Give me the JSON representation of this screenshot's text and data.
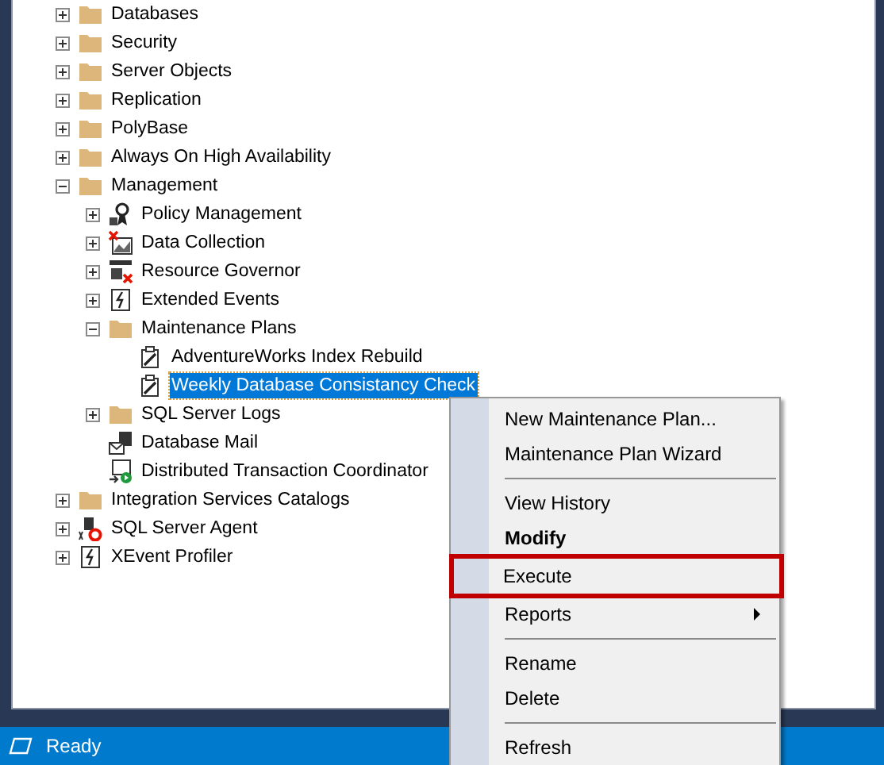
{
  "tree": [
    {
      "label": "Databases",
      "kind": "folder",
      "expanded": false,
      "selected": false
    },
    {
      "label": "Security",
      "kind": "folder",
      "expanded": false,
      "selected": false
    },
    {
      "label": "Server Objects",
      "kind": "folder",
      "expanded": false,
      "selected": false
    },
    {
      "label": "Replication",
      "kind": "folder",
      "expanded": false,
      "selected": false
    },
    {
      "label": "PolyBase",
      "kind": "folder",
      "expanded": false,
      "selected": false
    },
    {
      "label": "Always On High Availability",
      "kind": "folder",
      "expanded": false,
      "selected": false
    },
    {
      "label": "Management",
      "kind": "folder",
      "expanded": true,
      "selected": false,
      "children": [
        {
          "label": "Policy Management",
          "kind": "policy",
          "expanded": false,
          "selected": false
        },
        {
          "label": "Data Collection",
          "kind": "collection",
          "expanded": false,
          "selected": false
        },
        {
          "label": "Resource Governor",
          "kind": "governor",
          "expanded": false,
          "selected": false
        },
        {
          "label": "Extended Events",
          "kind": "events",
          "expanded": false,
          "selected": false
        },
        {
          "label": "Maintenance Plans",
          "kind": "folder",
          "expanded": true,
          "selected": false,
          "children": [
            {
              "label": "AdventureWorks Index Rebuild",
              "kind": "plan",
              "selected": false
            },
            {
              "label": "Weekly Database Consistancy Check",
              "kind": "plan",
              "selected": true
            }
          ]
        },
        {
          "label": "SQL Server Logs",
          "kind": "folder",
          "expanded": false,
          "selected": false
        },
        {
          "label": "Database Mail",
          "kind": "mail",
          "selected": false
        },
        {
          "label": "Distributed Transaction Coordinator",
          "kind": "dtc",
          "selected": false
        }
      ]
    },
    {
      "label": "Integration Services Catalogs",
      "kind": "folder",
      "expanded": false,
      "selected": false
    },
    {
      "label": "SQL Server Agent",
      "kind": "agent",
      "expanded": false,
      "selected": false
    },
    {
      "label": "XEvent Profiler",
      "kind": "events",
      "expanded": false,
      "selected": false
    }
  ],
  "context_menu": [
    {
      "kind": "item",
      "label": "New Maintenance Plan..."
    },
    {
      "kind": "item",
      "label": "Maintenance Plan Wizard"
    },
    {
      "kind": "separator"
    },
    {
      "kind": "item",
      "label": "View History"
    },
    {
      "kind": "item",
      "label": "Modify",
      "bold": true
    },
    {
      "kind": "item",
      "label": "Execute",
      "highlighted": true
    },
    {
      "kind": "item",
      "label": "Reports",
      "submenu": true
    },
    {
      "kind": "separator"
    },
    {
      "kind": "item",
      "label": "Rename"
    },
    {
      "kind": "item",
      "label": "Delete"
    },
    {
      "kind": "separator"
    },
    {
      "kind": "item",
      "label": "Refresh"
    }
  ],
  "status_bar": {
    "text": "Ready"
  }
}
